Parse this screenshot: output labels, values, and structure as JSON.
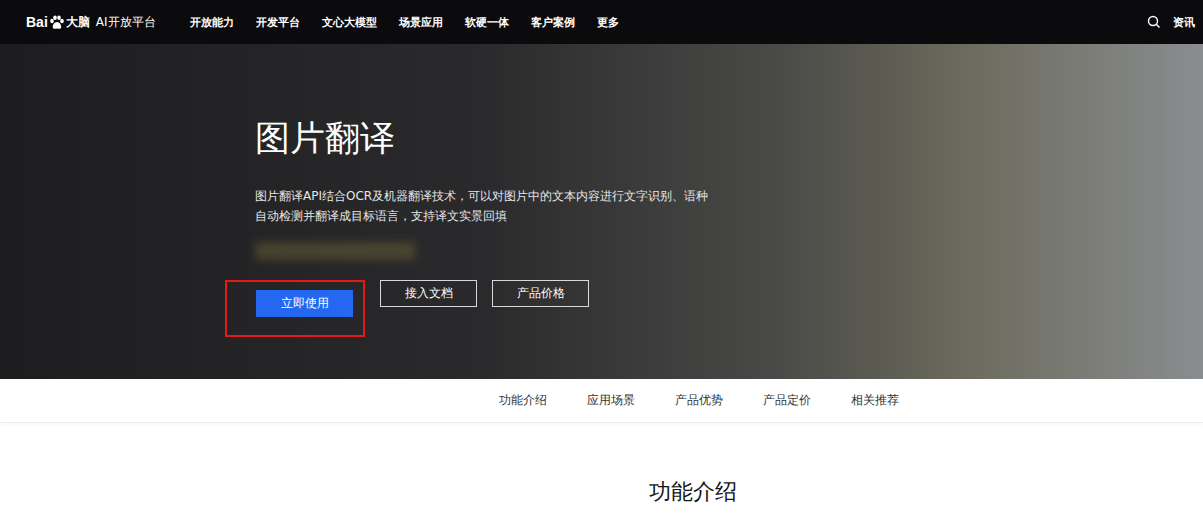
{
  "top_nav": {
    "logo": {
      "brand": "Bai",
      "brand_suffix": "大脑",
      "platform": "AI开放平台"
    },
    "items": [
      "开放能力",
      "开发平台",
      "文心大模型",
      "场景应用",
      "软硬一体",
      "客户案例",
      "更多"
    ],
    "right_links": [
      "资讯"
    ]
  },
  "hero": {
    "title": "图片翻译",
    "description": [
      "图片翻译API结合OCR及机器翻译技术，可以对图片中的文本内容进行文字识别、语种",
      "自动检测并翻译成目标语言，支持译文实景回填"
    ],
    "buttons": [
      {
        "label": "立即使用",
        "kind": "primary",
        "highlighted": true
      },
      {
        "label": "接入文档",
        "kind": "outline",
        "highlighted": false
      },
      {
        "label": "产品价格",
        "kind": "outline",
        "highlighted": false
      }
    ]
  },
  "sub_nav": {
    "items": [
      {
        "label": "功能介绍",
        "selected": false
      },
      {
        "label": "应用场景",
        "selected": false
      },
      {
        "label": "产品优势",
        "selected": false
      },
      {
        "label": "产品定价",
        "selected": false
      },
      {
        "label": "相关推荐",
        "selected": false
      }
    ]
  },
  "section": {
    "title": "功能介绍"
  }
}
